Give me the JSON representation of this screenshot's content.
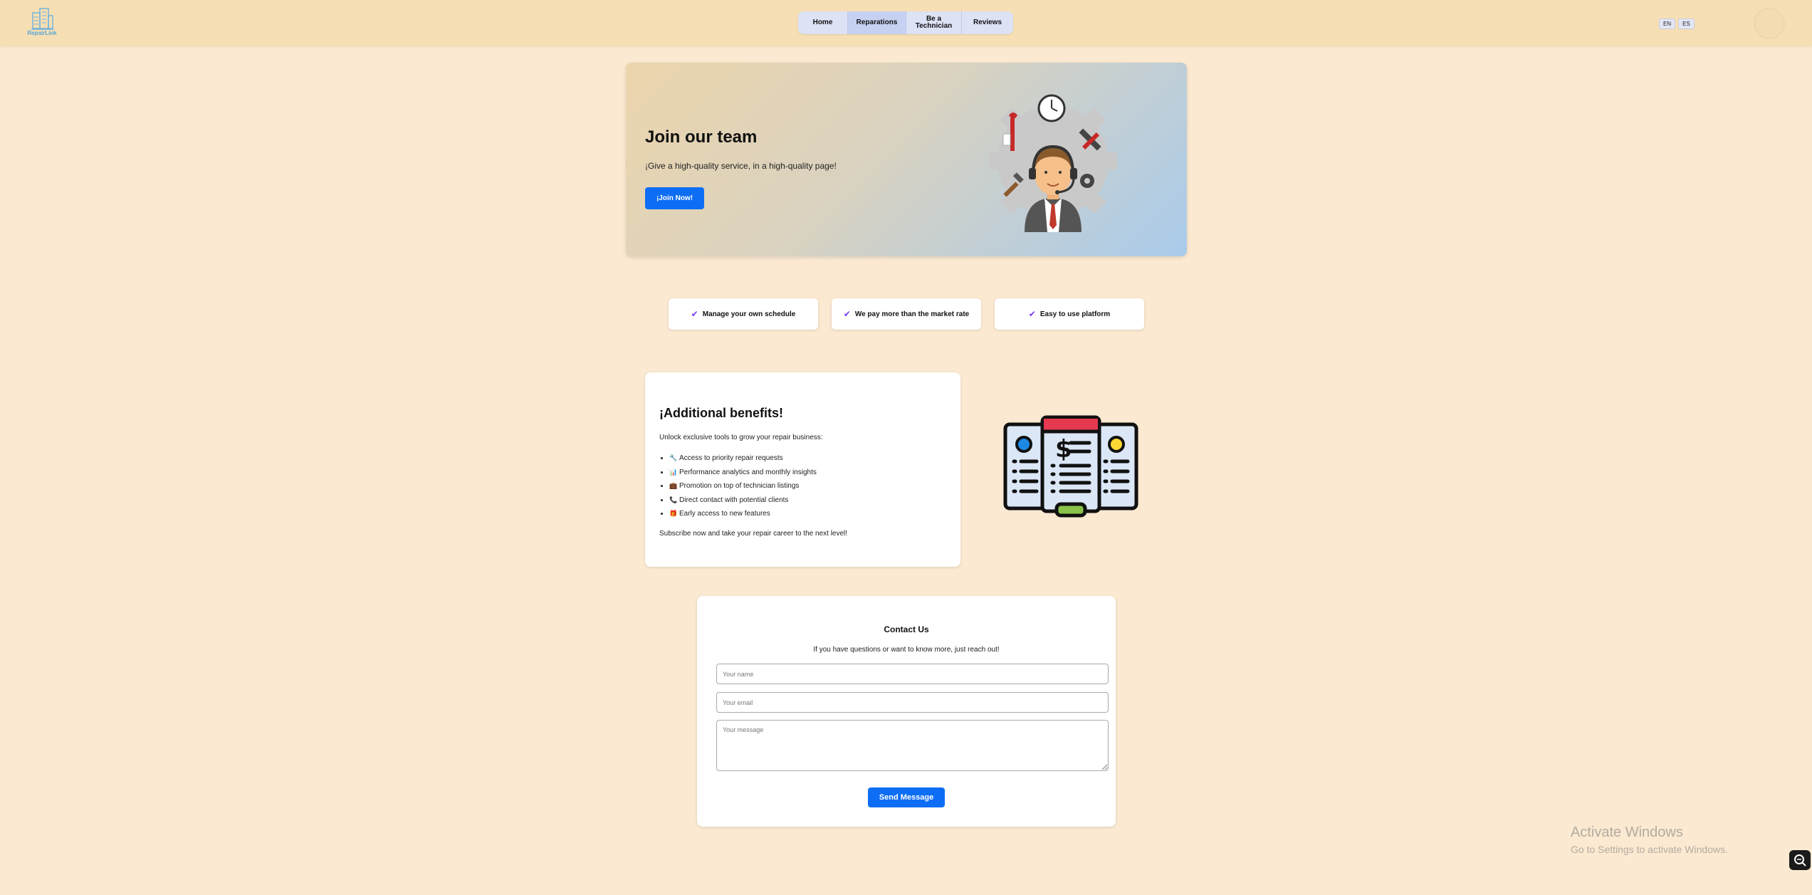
{
  "header": {
    "logo_text": "RepairLink",
    "nav": [
      {
        "label": "Home"
      },
      {
        "label": "Reparations"
      },
      {
        "label": "Be a Technician"
      },
      {
        "label": "Reviews"
      }
    ],
    "lang": [
      "EN",
      "ES"
    ]
  },
  "hero": {
    "title": "Join our team",
    "subtitle": "¡Give a high-quality service, in a high-quality page!",
    "button": "¡Join Now!"
  },
  "features": [
    {
      "label": "Manage your own schedule"
    },
    {
      "label": "We pay more than the market rate"
    },
    {
      "label": "Easy to use platform"
    }
  ],
  "benefits": {
    "title": "¡Additional benefits!",
    "intro": "Unlock exclusive tools to grow your repair business:",
    "items": [
      {
        "emoji": "🔧",
        "text": "Access to priority repair requests"
      },
      {
        "emoji": "📊",
        "text": "Performance analytics and monthly insights"
      },
      {
        "emoji": "💼",
        "text": "Promotion on top of technician listings"
      },
      {
        "emoji": "📞",
        "text": "Direct contact with potential clients"
      },
      {
        "emoji": "🎁",
        "text": "Early access to new features"
      }
    ],
    "outro": "Subscribe now and take your repair career to the next level!"
  },
  "contact": {
    "title": "Contact Us",
    "subtitle": "If you have questions or want to know more, just reach out!",
    "name_placeholder": "Your name",
    "email_placeholder": "Your email",
    "message_placeholder": "Your message",
    "send": "Send Message"
  },
  "watermark": {
    "line1": "Activate Windows",
    "line2": "Go to Settings to activate Windows."
  },
  "colors": {
    "page_bg": "#fbe9d1",
    "header_bg": "#f6dfb4",
    "primary": "#0d6ef5",
    "check": "#7c3aed"
  }
}
